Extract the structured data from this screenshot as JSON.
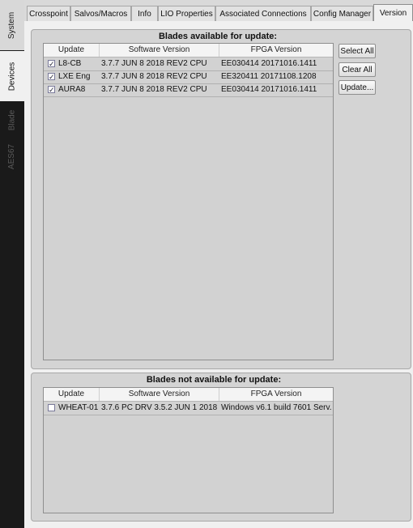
{
  "sidebar": {
    "tabs": [
      {
        "label": "System"
      },
      {
        "label": "Devices"
      },
      {
        "label": "Blade"
      },
      {
        "label": "AES67"
      }
    ]
  },
  "tabs": [
    {
      "label": "Crosspoint"
    },
    {
      "label": "Salvos/Macros"
    },
    {
      "label": "Info"
    },
    {
      "label": "LIO Properties"
    },
    {
      "label": "Associated Connections"
    },
    {
      "label": "Config Manager"
    },
    {
      "label": "Version"
    }
  ],
  "available": {
    "title": "Blades available for update:",
    "columns": [
      "Update",
      "Software Version",
      "FPGA Version"
    ],
    "rows": [
      {
        "checked": true,
        "name": "L8-CB",
        "software": "3.7.7 JUN 8 2018 REV2 CPU",
        "fpga": "EE030414 20171016.1411"
      },
      {
        "checked": true,
        "name": "LXE Eng",
        "software": "3.7.7 JUN 8 2018 REV2 CPU",
        "fpga": "EE320411 20171108.1208"
      },
      {
        "checked": true,
        "name": "AURA8",
        "software": "3.7.7 JUN 8 2018 REV2 CPU",
        "fpga": "EE030414 20171016.1411"
      }
    ],
    "buttons": {
      "select_all": "Select All",
      "clear_all": "Clear All",
      "update": "Update..."
    }
  },
  "not_available": {
    "title": "Blades not available for update:",
    "columns": [
      "Update",
      "Software Version",
      "FPGA Version"
    ],
    "rows": [
      {
        "checked": false,
        "name": "WHEAT-01",
        "software": "3.7.6 PC DRV 3.5.2 JUN 1 2018",
        "fpga": "Windows v6.1 build 7601 Serv..."
      }
    ]
  },
  "check_mark": "✓"
}
